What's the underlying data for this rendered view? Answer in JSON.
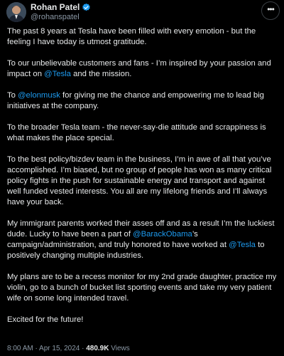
{
  "author": {
    "display_name": "Rohan Patel",
    "handle": "@rohanspatel",
    "verified": true,
    "avatar_icon": "avatar-photo",
    "verified_icon": "verified-badge-icon",
    "more_icon": "more-options-icon"
  },
  "colors": {
    "background": "#000000",
    "text": "#e7e9ea",
    "muted": "#8b98a5",
    "link": "#1d9bf0"
  },
  "tweet": {
    "paragraphs": [
      [
        {
          "text": "The past 8 years at Tesla have been filled with every emotion - but the feeling I have today is utmost gratitude."
        }
      ],
      [
        {
          "text": "To our unbelievable customers and fans - I’m inspired by your passion and impact on "
        },
        {
          "text": "@Tesla",
          "mention": true
        },
        {
          "text": " and the mission."
        }
      ],
      [
        {
          "text": "To "
        },
        {
          "text": "@elonmusk",
          "mention": true
        },
        {
          "text": " for giving me the chance and empowering me to lead big initiatives at the company."
        }
      ],
      [
        {
          "text": "To the broader Tesla team - the never-say-die attitude and scrappiness is what makes the place special."
        }
      ],
      [
        {
          "text": "To the best policy/bizdev team in the business, I’m in awe of all that you’ve accomplished. I’m biased, but no group of people has won as many critical policy fights in the push for sustainable energy and transport and against well funded vested interests. You all are my lifelong friends and I’ll always have your back."
        }
      ],
      [
        {
          "text": "My immigrant parents worked their asses off and as a result I’m the luckiest dude. Lucky to have been a part of "
        },
        {
          "text": "@BarackObama",
          "mention": true
        },
        {
          "text": "’s campaign/administration, and truly honored to have worked at "
        },
        {
          "text": "@Tesla",
          "mention": true
        },
        {
          "text": " to positively changing multiple industries."
        }
      ],
      [
        {
          "text": "My plans are to be a recess monitor for my 2nd grade daughter, practice my violin, go to a bunch of bucket list sporting events and take my very patient wife on some long intended travel."
        }
      ],
      [
        {
          "text": "Excited for the future!"
        }
      ]
    ]
  },
  "meta": {
    "time": "8:00 AM",
    "separator": " · ",
    "date": "Apr 15, 2024",
    "views_count": "480.9K",
    "views_label": " Views"
  }
}
